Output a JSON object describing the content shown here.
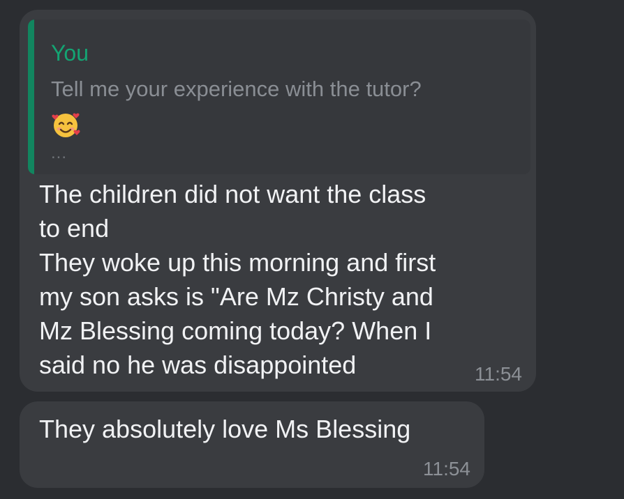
{
  "conversation": {
    "message_1": {
      "reply_quote": {
        "author": "You",
        "text": "Tell me your experience with the tutor?",
        "emoji": "smiling-face-with-hearts",
        "more": "..."
      },
      "lines": [
        "The children did not want the class",
        "to end",
        "They woke up this morning and first",
        "my son asks is \"Are Mz Christy and",
        "Mz Blessing coming today? When I",
        "said no he was disappointed"
      ],
      "time": "11:54"
    },
    "message_2": {
      "text": "They absolutely love Ms Blessing",
      "time": "11:54"
    }
  },
  "colors": {
    "background": "#2b2d31",
    "bubble": "#3a3c40",
    "quote_accent": "#12855f",
    "quote_author": "#14a473"
  }
}
